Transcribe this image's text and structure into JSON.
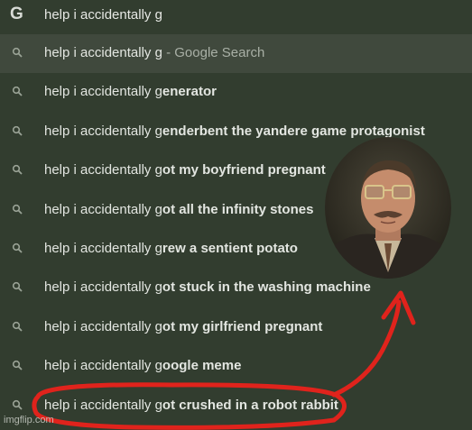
{
  "omnibox": {
    "logo": "G",
    "query": "help i accidentally g"
  },
  "suggestions": [
    {
      "typed": "help i accidentally g",
      "completion": "",
      "suffix": " - Google Search"
    },
    {
      "typed": "help i accidentally g",
      "completion": "enerator",
      "suffix": ""
    },
    {
      "typed": "help i accidentally g",
      "completion": "enderbent the yandere game protagonist",
      "suffix": ""
    },
    {
      "typed": "help i accidentally g",
      "completion": "ot my boyfriend pregnant",
      "suffix": ""
    },
    {
      "typed": "help i accidentally g",
      "completion": "ot all the infinity stones",
      "suffix": ""
    },
    {
      "typed": "help i accidentally g",
      "completion": "rew a sentient potato",
      "suffix": ""
    },
    {
      "typed": "help i accidentally g",
      "completion": "ot stuck in the washing machine",
      "suffix": ""
    },
    {
      "typed": "help i accidentally g",
      "completion": "ot my girlfriend pregnant",
      "suffix": ""
    },
    {
      "typed": "help i accidentally g",
      "completion": "oogle meme",
      "suffix": ""
    },
    {
      "typed": "help i accidentally g",
      "completion": "ot crushed in a robot rabbit",
      "suffix": ""
    }
  ],
  "icons": {
    "suggestion": "search-icon",
    "logo": "google-logo"
  },
  "colors": {
    "background": "#323d2f",
    "selected_row": "#40493d",
    "annotation": "#e0231c"
  },
  "watermark": "imgflip.com"
}
